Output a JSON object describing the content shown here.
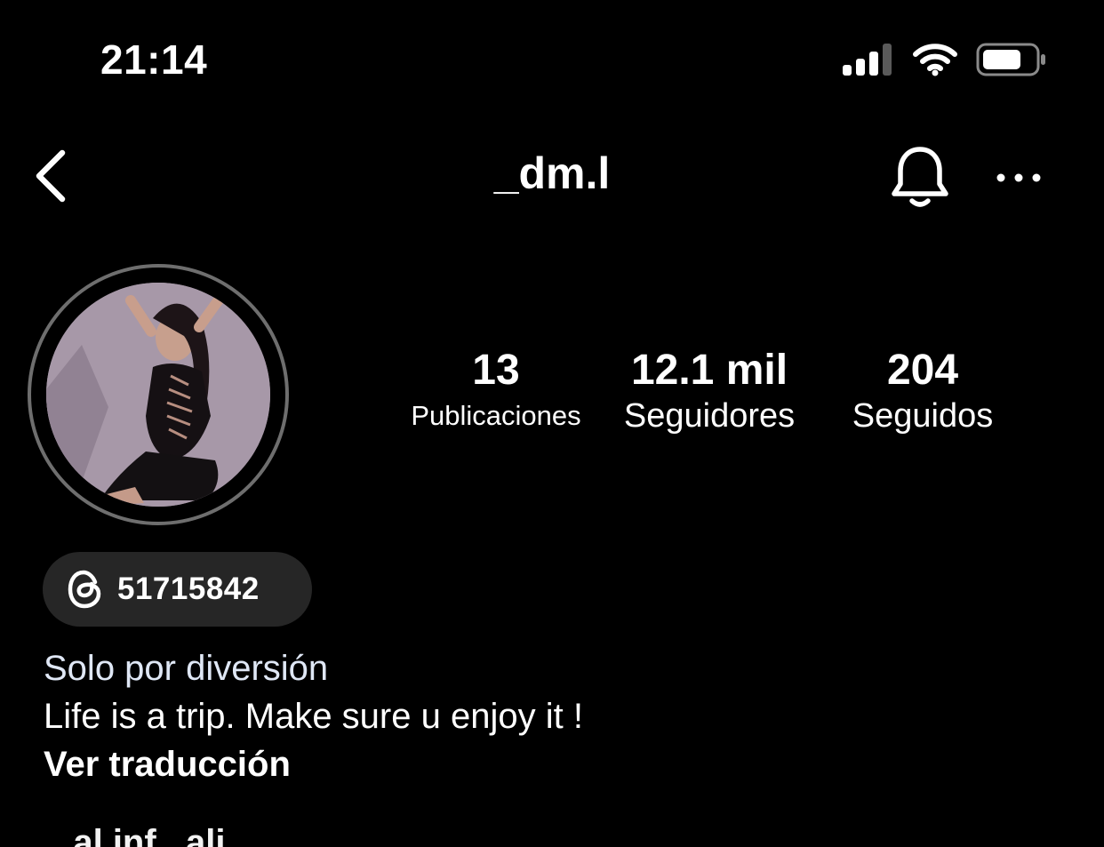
{
  "status_bar": {
    "time": "21:14"
  },
  "header": {
    "username": "_dm.l"
  },
  "profile": {
    "stats": {
      "posts_value": "13",
      "posts_label": "Publicaciones",
      "followers_value": "12.1 mil",
      "followers_label": "Seguidores",
      "following_value": "204",
      "following_label": "Seguidos"
    },
    "threads_count": "51715842",
    "bio": {
      "category": "Solo por diversión",
      "text": "Life is a trip. Make sure u enjoy it !",
      "translate": "Ver traducción",
      "cut_line": "...al inf...ali..."
    }
  },
  "colors": {
    "background": "#000000",
    "pill": "#262626",
    "ring": "#6e6e6e",
    "category": "#dfe7f5"
  }
}
